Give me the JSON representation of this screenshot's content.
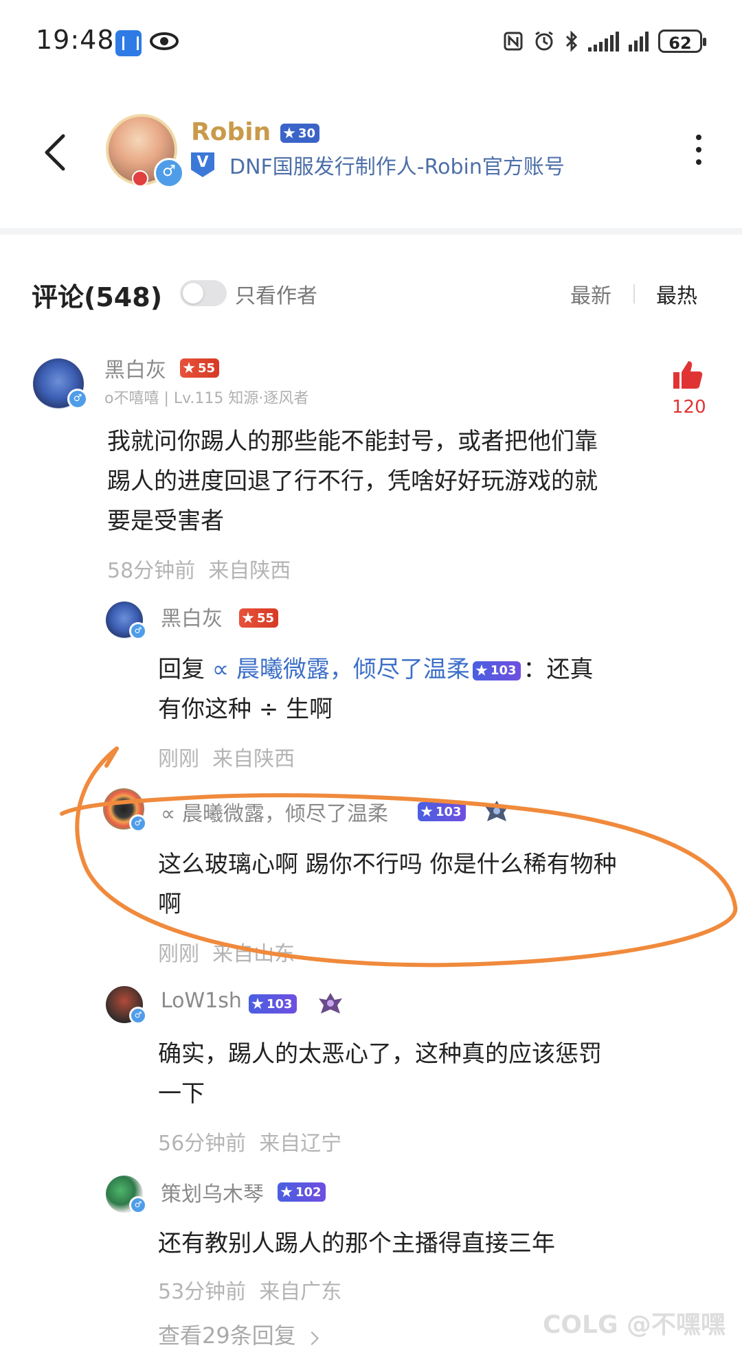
{
  "status_bar": {
    "time": "19:48",
    "battery": "62"
  },
  "header": {
    "author_name": "Robin",
    "author_level": "30",
    "verified_badge": "V",
    "author_description": "DNF国服发行制作人-Robin官方账号"
  },
  "comments_header": {
    "title": "评论(548)",
    "author_only_label": "只看作者",
    "sort_newest": "最新",
    "sort_hot": "最热"
  },
  "main_comment": {
    "username": "黑白灰",
    "level": "55",
    "meta": "o不嘻嘻 | Lv.115 知源·逐风者",
    "text_line1": "我就问你踢人的那些能不能封号，或者把他们靠",
    "text_line2": "踢人的进度回退了行不行，凭啥好好玩游戏的就",
    "text_line3": "要是受害者",
    "time": "58分钟前",
    "location": "来自陕西",
    "likes": "120"
  },
  "replies": [
    {
      "username": "黑白灰",
      "level": "55",
      "reply_prefix": "回复",
      "reply_target": "∝ 晨曦微露，倾尽了温柔",
      "target_level": "103",
      "text_line1_tail": "：还真",
      "text_line2": "有你这种 ÷ 生啊",
      "time": "刚刚",
      "location": "来自陕西"
    },
    {
      "username": "∝ 晨曦微露，倾尽了温柔",
      "level": "103",
      "text_line1": "这么玻璃心啊 踢你不行吗 你是什么稀有物种",
      "text_line2": "啊",
      "time": "刚刚",
      "location": "来自山东"
    },
    {
      "username": "LoW1sh",
      "level": "103",
      "text_line1": "确实，踢人的太恶心了，这种真的应该惩罚",
      "text_line2": "一下",
      "time": "56分钟前",
      "location": "来自辽宁"
    },
    {
      "username": "策划乌木琴",
      "level": "102",
      "text_line1": "还有教别人踢人的那个主播得直接三年",
      "time": "53分钟前",
      "location": "来自广东"
    }
  ],
  "view_more": "查看29条回复",
  "watermark": "COLG @不嘿嘿",
  "colors": {
    "accent_blue": "#3d6fc8",
    "like_red": "#e03434",
    "annotation_orange": "#f08a3c",
    "author_gold": "#c99a4a"
  }
}
